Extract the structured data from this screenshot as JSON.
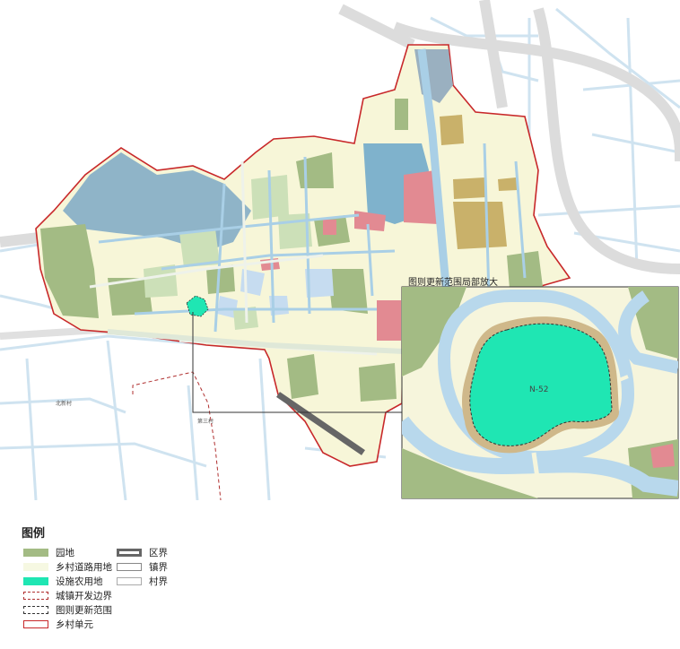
{
  "map": {
    "inset_title": "图则更新范围局部放大",
    "inset_parcel_label": "N-52",
    "place_labels": [
      "北新村",
      "第三村"
    ]
  },
  "legend": {
    "title": "图例",
    "items": [
      {
        "key": "garden",
        "label": "园地",
        "color": "#a3bb84"
      },
      {
        "key": "rural-road",
        "label": "乡村道路用地",
        "color": "#f6f8e2"
      },
      {
        "key": "facility-farm",
        "label": "设施农用地",
        "color": "#1fe6b3"
      },
      {
        "key": "urban-dev-boundary",
        "label": "城镇开发边界",
        "color": "#b03030"
      },
      {
        "key": "update-range",
        "label": "图则更新范围",
        "color": "#333333"
      },
      {
        "key": "rural-unit",
        "label": "乡村单元",
        "color": "#c8282a"
      },
      {
        "key": "district-boundary",
        "label": "区界",
        "color": "#666666"
      },
      {
        "key": "town-boundary",
        "label": "镇界",
        "color": "#888888"
      },
      {
        "key": "village-boundary",
        "label": "村界",
        "color": "#aaaaaa"
      }
    ]
  }
}
